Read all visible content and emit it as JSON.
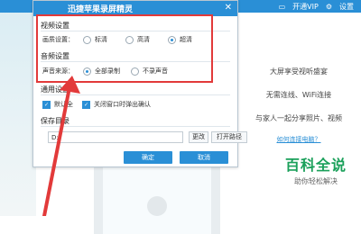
{
  "topbar": {
    "vip_label": "开通VIP",
    "settings_label": "设置"
  },
  "dialog": {
    "title": "迅捷苹果录屏精灵",
    "video_section": "视频设置",
    "quality_label": "画质设置：",
    "quality_options": [
      "标清",
      "高清",
      "超清"
    ],
    "quality_selected": "超清",
    "audio_section": "音频设置",
    "audio_label": "声音来源：",
    "audio_options": [
      "全部录制",
      "不录声音"
    ],
    "audio_selected": "全部录制",
    "general_section": "通用设置",
    "default_check": "默认全",
    "close_check": "关闭窗口时弹出确认",
    "save_section": "保存目录",
    "save_path": "D:\\",
    "change_btn": "更改",
    "open_btn": "打开路径",
    "ok_btn": "确定",
    "cancel_btn": "取消"
  },
  "ad": {
    "line1": "大屏享受视听盛宴",
    "line2": "无需连线、WiFi连接",
    "line3": "与家人一起分享照片、视频",
    "link": "如何连接电脑？"
  },
  "watermark": {
    "big": "百科全说",
    "small": "助你轻松解决"
  },
  "colors": {
    "accent": "#2a8fd6",
    "highlight": "#e23a3a",
    "brand_green": "#1aa05a"
  }
}
